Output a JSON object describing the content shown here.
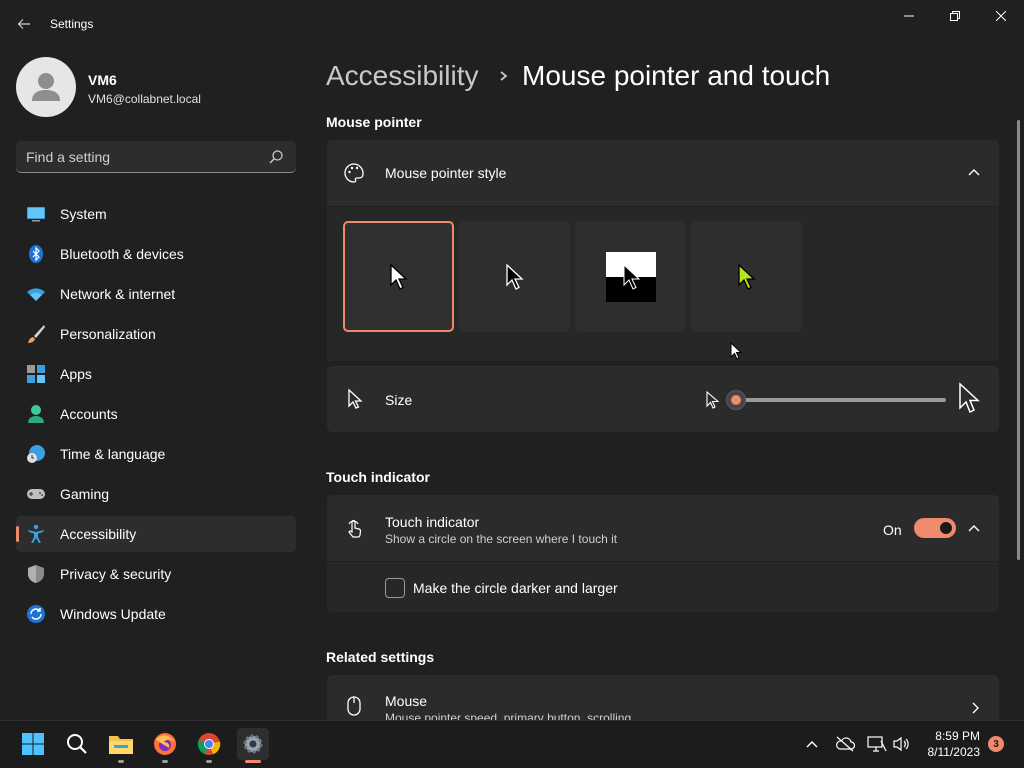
{
  "window": {
    "title": "Settings"
  },
  "profile": {
    "name": "VM6",
    "email": "VM6@collabnet.local"
  },
  "search": {
    "placeholder": "Find a setting"
  },
  "sidebar": {
    "items": [
      {
        "label": "System",
        "icon": "monitor-icon"
      },
      {
        "label": "Bluetooth & devices",
        "icon": "bluetooth-icon"
      },
      {
        "label": "Network & internet",
        "icon": "wifi-icon"
      },
      {
        "label": "Personalization",
        "icon": "brush-icon"
      },
      {
        "label": "Apps",
        "icon": "apps-icon"
      },
      {
        "label": "Accounts",
        "icon": "person-icon"
      },
      {
        "label": "Time & language",
        "icon": "globe-clock-icon"
      },
      {
        "label": "Gaming",
        "icon": "gamepad-icon"
      },
      {
        "label": "Accessibility",
        "icon": "accessibility-icon",
        "active": true
      },
      {
        "label": "Privacy & security",
        "icon": "shield-icon"
      },
      {
        "label": "Windows Update",
        "icon": "update-icon"
      }
    ]
  },
  "breadcrumb": {
    "parent": "Accessibility",
    "current": "Mouse pointer and touch"
  },
  "mouse_pointer": {
    "section_title": "Mouse pointer",
    "style_label": "Mouse pointer style",
    "styles": [
      "white",
      "black",
      "inverted",
      "custom"
    ],
    "selected_style_index": 0,
    "size_label": "Size",
    "size_value_fraction": 0.0
  },
  "touch": {
    "section_title": "Touch indicator",
    "title": "Touch indicator",
    "subtitle": "Show a circle on the screen where I touch it",
    "toggle_state": "On",
    "checkbox_label": "Make the circle darker and larger",
    "checkbox_checked": false
  },
  "related": {
    "section_title": "Related settings",
    "mouse_title": "Mouse",
    "mouse_sub": "Mouse pointer speed, primary button, scrolling"
  },
  "taskbar": {
    "time": "8:59 PM",
    "date": "8/11/2023",
    "notification_count": "3"
  },
  "colors": {
    "accent": "#f08a6c",
    "background": "#202020",
    "card": "#2b2b2b",
    "custom_pointer": "#b5e61d"
  }
}
